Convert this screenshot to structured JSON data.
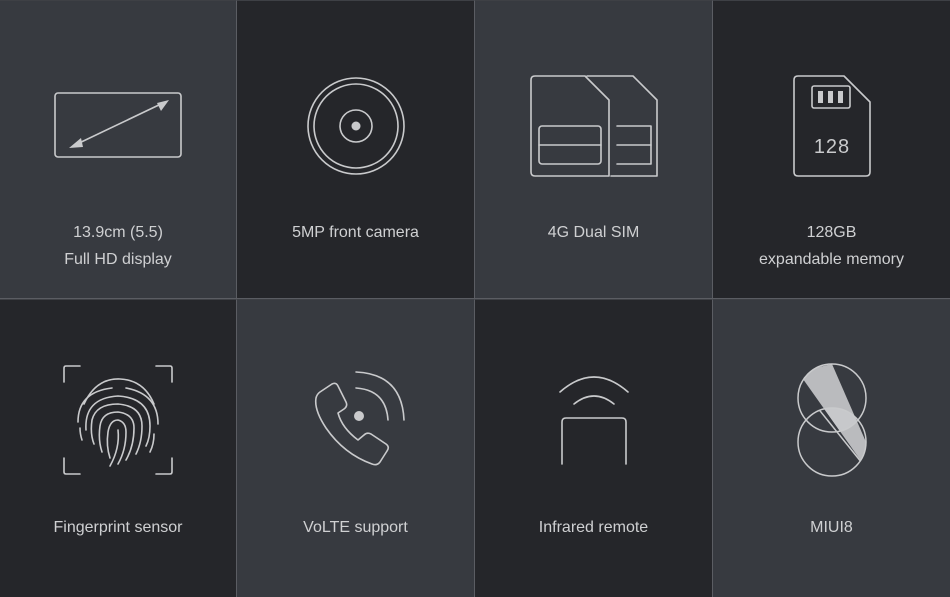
{
  "features": [
    {
      "id": "display",
      "icon": "display-diagonal-icon",
      "lines": [
        "13.9cm (5.5)",
        "Full HD display"
      ]
    },
    {
      "id": "camera",
      "icon": "camera-lens-icon",
      "lines": [
        "5MP front camera"
      ]
    },
    {
      "id": "sim",
      "icon": "dual-sim-icon",
      "lines": [
        "4G Dual SIM"
      ]
    },
    {
      "id": "memory",
      "icon": "sd-card-icon",
      "icon_text": "128",
      "lines": [
        "128GB",
        "expandable memory"
      ]
    },
    {
      "id": "fingerprint",
      "icon": "fingerprint-icon",
      "lines": [
        "Fingerprint sensor"
      ]
    },
    {
      "id": "volte",
      "icon": "phone-signal-icon",
      "lines": [
        "VoLTE support"
      ]
    },
    {
      "id": "infrared",
      "icon": "infrared-remote-icon",
      "lines": [
        "Infrared remote"
      ]
    },
    {
      "id": "miui",
      "icon": "miui8-logo-icon",
      "lines": [
        "MIUI8"
      ]
    }
  ],
  "colors": {
    "dark_tile": "#25262a",
    "light_tile": "#373a40",
    "icon_stroke": "#c9cacc",
    "divider": "#5b5d63"
  }
}
